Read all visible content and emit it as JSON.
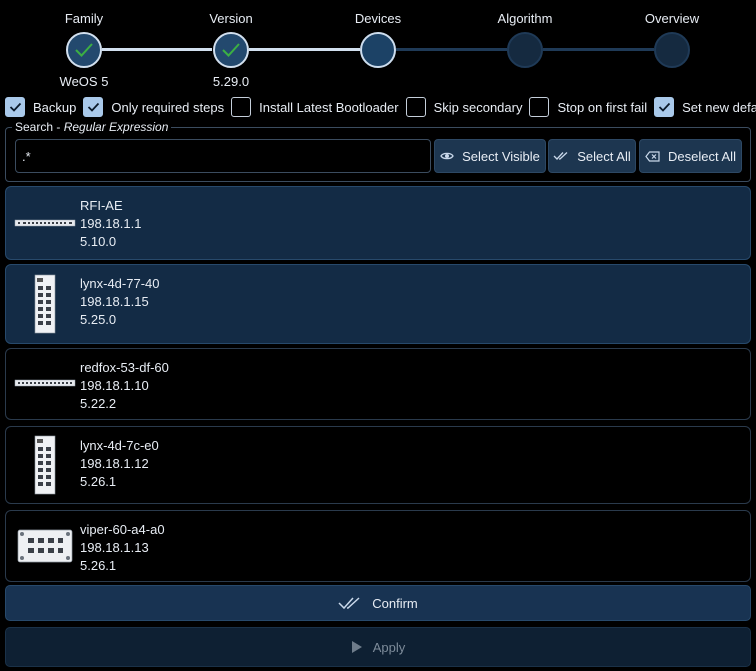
{
  "stepper": {
    "steps": [
      {
        "title": "Family",
        "sub": "WeOS 5",
        "state": "done"
      },
      {
        "title": "Version",
        "sub": "5.29.0",
        "state": "done"
      },
      {
        "title": "Devices",
        "sub": "",
        "state": "current"
      },
      {
        "title": "Algorithm",
        "sub": "",
        "state": "todo"
      },
      {
        "title": "Overview",
        "sub": "",
        "state": "todo"
      }
    ]
  },
  "options": [
    {
      "label": "Backup",
      "checked": true
    },
    {
      "label": "Only required steps",
      "checked": true
    },
    {
      "label": "Install Latest Bootloader",
      "checked": false
    },
    {
      "label": "Skip secondary",
      "checked": false
    },
    {
      "label": "Stop on first fail",
      "checked": false
    },
    {
      "label": "Set new defaults",
      "checked": true
    }
  ],
  "search": {
    "label": "Search - ",
    "label_italic": "Regular Expression",
    "value": ".*",
    "select_visible": "Select Visible",
    "select_all": "Select All",
    "deselect_all": "Deselect All"
  },
  "devices": [
    {
      "name": "RFI-AE",
      "ip": "198.18.1.1",
      "version": "5.10.0",
      "selected": true,
      "form": "rack"
    },
    {
      "name": "lynx-4d-77-40",
      "ip": "198.18.1.15",
      "version": "5.25.0",
      "selected": true,
      "form": "din"
    },
    {
      "name": "redfox-53-df-60",
      "ip": "198.18.1.10",
      "version": "5.22.2",
      "selected": false,
      "form": "rack"
    },
    {
      "name": "lynx-4d-7c-e0",
      "ip": "198.18.1.12",
      "version": "5.26.1",
      "selected": false,
      "form": "din"
    },
    {
      "name": "viper-60-a4-a0",
      "ip": "198.18.1.13",
      "version": "5.26.1",
      "selected": false,
      "form": "box"
    }
  ],
  "actions": {
    "confirm": "Confirm",
    "apply": "Apply"
  },
  "colors": {
    "accent": "#a9c9ea",
    "selected_bg": "#132b45",
    "success": "#3cb043"
  }
}
